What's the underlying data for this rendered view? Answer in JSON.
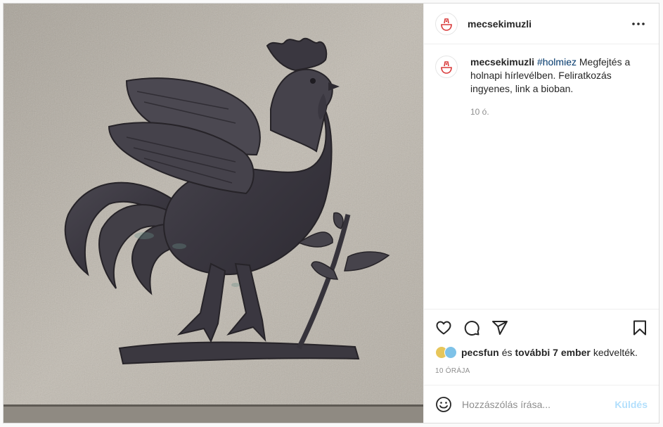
{
  "post": {
    "username": "mecsekimuzli",
    "image_alt": "Bronze rooster relief on a stone wall"
  },
  "caption": {
    "username": "mecsekimuzli",
    "hashtag": "#holmiez",
    "text": " Megfejtés a holnapi hírlevélben. Feliratkozás ingyenes, link a bioban.",
    "time": "10 ó."
  },
  "likes": {
    "first_user": "pecsfun",
    "and": "és",
    "others": "további 7 ember",
    "suffix": "kedvelték."
  },
  "timestamp": "10 órája",
  "comment": {
    "placeholder": "Hozzászólás írása...",
    "send_label": "Küldés"
  },
  "icons": {
    "more": "more-horizontal-icon",
    "like": "heart-icon",
    "comment": "comment-icon",
    "share": "paper-plane-icon",
    "save": "bookmark-icon",
    "emoji": "smiley-icon"
  },
  "colors": {
    "hashtag": "#00376b",
    "send_disabled": "#b2dffc",
    "secondary_text": "#8e8e8e",
    "logo_red": "#d93a3a"
  }
}
